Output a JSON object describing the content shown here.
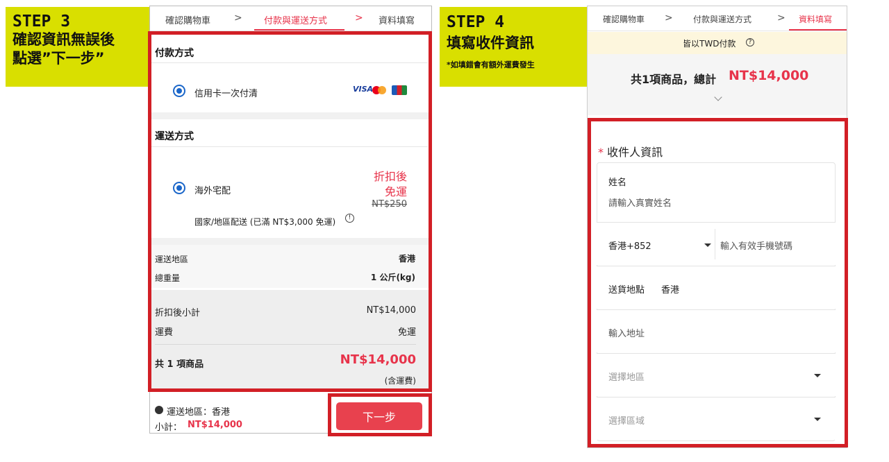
{
  "step3": {
    "title": "STEP 3",
    "line1": "確認資訊無誤後",
    "line2": "點選”下一步”"
  },
  "step4": {
    "title": "STEP 4",
    "line1": "填寫收件資訊",
    "note": "*如填錯會有額外運費發生"
  },
  "checkout_tabs": [
    "確認購物車",
    "付款與運送方式",
    "資料填寫"
  ],
  "tab_separator": ">",
  "payment": {
    "section_title": "付款方式",
    "option_label": "信用卡一次付清",
    "card_brands": [
      "VISA",
      "mastercard",
      "JCB"
    ]
  },
  "shipping": {
    "section_title": "運送方式",
    "option_label": "海外宅配",
    "discount_label": "折扣後",
    "discount_value": "免運",
    "original_fee": "NT$250",
    "note": "國家/地區配送 (已滿 NT$3,000 免運)",
    "info_icon": "info-circle-icon"
  },
  "summary": {
    "region_label": "運送地區",
    "region_value": "香港",
    "weight_label": "總重量",
    "weight_value": "1 公斤(kg)",
    "subtotal_label": "折扣後小計",
    "subtotal_value": "NT$14,000",
    "fee_label": "運費",
    "fee_value": "免運",
    "total_label": "共 1 項商品",
    "total_value": "NT$14,000",
    "total_note": "(含運費)"
  },
  "footer": {
    "region_text": "運送地區：香港",
    "subtotal_label": "小計：",
    "subtotal_value": "NT$14,000",
    "next_button": "下一步"
  },
  "step4_screen": {
    "currency_notice": "皆以TWD付款",
    "help_icon": "question-circle-icon",
    "total_text": "共1項商品，總計",
    "total_value": "NT$14,000",
    "recipient_required": "*",
    "recipient_title": "收件人資訊",
    "name_label": "姓名",
    "name_placeholder": "請輸入真實姓名",
    "phone_country": "香港+852",
    "phone_placeholder": "輸入有效手機號碼",
    "delivery_label": "送貨地點",
    "delivery_value": "香港",
    "address_placeholder": "輸入地址",
    "region_select": "選擇地區",
    "district_select": "選擇區域"
  },
  "colors": {
    "accent_red": "#e7334a",
    "frame_red": "#d21f26",
    "step_label_yellow": "#d9df00",
    "radio_blue": "#1a66c9"
  }
}
